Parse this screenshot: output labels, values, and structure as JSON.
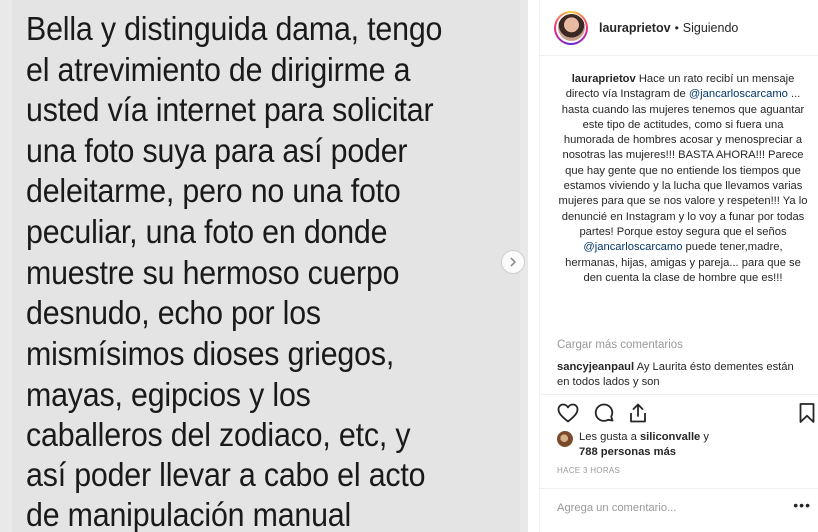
{
  "photo": {
    "lines": [
      "Bella y distinguida dama, tengo",
      "el atrevimiento de dirigirme a",
      "usted vía internet para solicitar",
      "una foto suya para así poder",
      "deleitarme, pero no una foto",
      "peculiar, una foto en donde",
      "muestre su hermoso cuerpo",
      "desnudo, echo por los",
      "mismísimos dioses griegos,",
      "mayas, egipcios y los",
      "caballeros del zodiaco, etc, y",
      "así poder llevar a cabo el acto",
      "de manipulación manual"
    ]
  },
  "header": {
    "username": "lauraprietov",
    "separator": "•",
    "follow_status": "Siguiendo"
  },
  "caption": {
    "username": "lauraprietov",
    "text_1": " Hace un rato recibí un mensaje directo vía Instagram de ",
    "mention_1": "@jancarloscarcamo",
    "text_2": " ... hasta cuando las mujeres tenemos que aguantar este tipo de actitudes, como si fuera una humorada de hombres acosar y menospreciar a nosotras las mujeres!!! BASTA AHORA!!! Parece que hay gente que no entiende los tiempos que estamos viviendo y la lucha que llevamos varias mujeres para que se nos valore y respeten!!! Ya lo denuncié en Instagram y lo voy a funar por todas partes! Porque estoy segura que el seños ",
    "mention_2": "@jancarloscarcamo",
    "text_3": " puede tener,madre, hermanas, hijas, amigas y pareja... para que se den cuenta la clase de hombre que es!!!"
  },
  "comments": {
    "load_more": "Cargar más comentarios",
    "items": [
      {
        "username": "sancyjeanpaul",
        "text": " Ay Laurita ésto dementes están en todos lados y son"
      }
    ]
  },
  "actions": {
    "like_icon": "heart-icon",
    "comment_icon": "speech-bubble-icon",
    "share_icon": "share-icon",
    "save_icon": "bookmark-icon"
  },
  "likes": {
    "prefix": "Les gusta a ",
    "user": "siliconvalle",
    "middle": " y",
    "count": "788 personas más"
  },
  "time_ago": "HACE 3 HORAS",
  "add_comment": {
    "placeholder": "Agrega un comentario...",
    "more": "•••"
  },
  "colors": {
    "text": "#262626",
    "muted": "#999999",
    "mention": "#003569",
    "border": "#efefef"
  }
}
